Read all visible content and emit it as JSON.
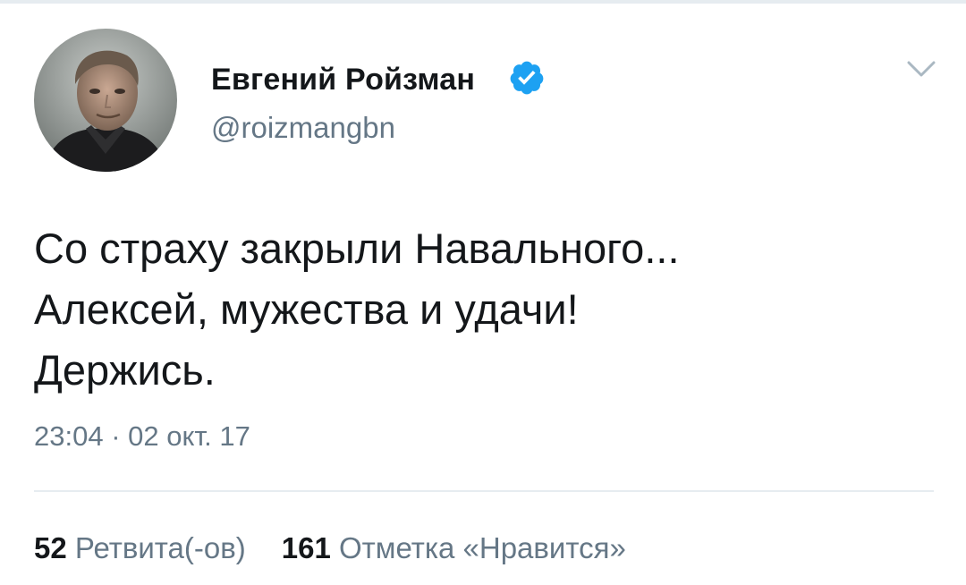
{
  "header": {
    "display_name": "Евгений Ройзман",
    "handle": "@roizmangbn",
    "verified": true,
    "avatar_icon": "user-avatar-photo",
    "menu_icon": "chevron-down-icon"
  },
  "tweet": {
    "lines": [
      "Со страху закрыли Навального...",
      "Алексей, мужества и удачи!",
      "Держись."
    ],
    "timestamp": "23:04 · 02 окт. 17"
  },
  "stats": {
    "retweets_count": "52",
    "retweets_label": "Ретвита(-ов)",
    "likes_count": "161",
    "likes_label": "Отметка «Нравится»"
  },
  "colors": {
    "text_primary": "#14171a",
    "text_secondary": "#657786",
    "verified_blue": "#1da1f2",
    "divider": "#e6ecf0"
  }
}
